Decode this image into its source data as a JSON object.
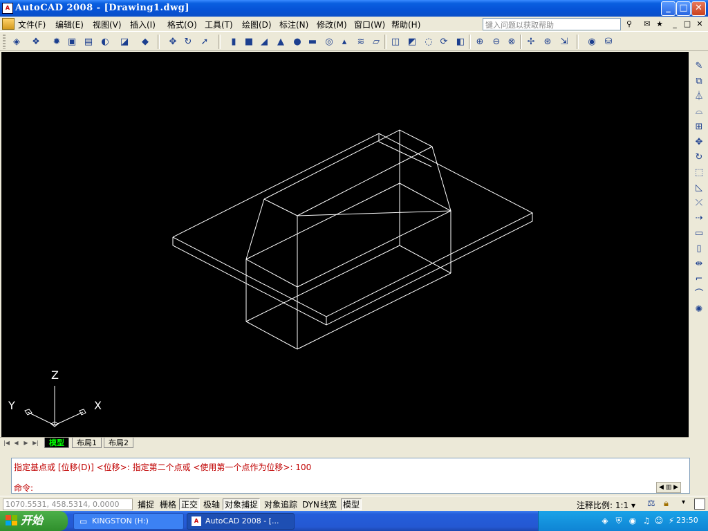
{
  "window": {
    "title": "AutoCAD 2008 - [Drawing1.dwg]",
    "app_icon_text": "A",
    "minimize": "_",
    "maximize": "□",
    "close": "✕"
  },
  "menubar": {
    "items": [
      "文件(F)",
      "编辑(E)",
      "视图(V)",
      "插入(I)",
      "格式(O)",
      "工具(T)",
      "绘图(D)",
      "标注(N)",
      "修改(M)",
      "窗口(W)",
      "帮助(H)"
    ],
    "help_search_placeholder": "键入问题以获取帮助",
    "doc_minimize": "_",
    "doc_restore": "□",
    "doc_close": "✕"
  },
  "drawing": {
    "ucs": {
      "z_label": "Z",
      "y_label": "Y",
      "x_label": "X"
    }
  },
  "layout_tabs": {
    "tabs": [
      "模型",
      "布局1",
      "布局2"
    ],
    "active": "模型"
  },
  "command": {
    "history_line": "指定基点或 [位移(D)] <位移>:  指定第二个点或 <使用第一个点作为位移>: 100",
    "prompt": "命令:"
  },
  "statusbar": {
    "coordinates": "1070.5531, 458.5314, 0.0000",
    "toggles": [
      {
        "label": "捕捉",
        "on": false
      },
      {
        "label": "栅格",
        "on": false
      },
      {
        "label": "正交",
        "on": true
      },
      {
        "label": "极轴",
        "on": false
      },
      {
        "label": "对象捕捉",
        "on": true
      },
      {
        "label": "对象追踪",
        "on": false
      },
      {
        "label": "DYN",
        "on": false
      },
      {
        "label": "线宽",
        "on": false
      },
      {
        "label": "模型",
        "on": true
      }
    ],
    "annotation_scale_label": "注释比例:",
    "annotation_scale_value": "1:1"
  },
  "taskbar": {
    "start_label": "开始",
    "tasks": [
      "KINGSTON (H:)",
      "AutoCAD 2008 - [..."
    ],
    "clock": "23:50"
  },
  "colors": {
    "canvas": "#000000",
    "wireframe": "#ffffff",
    "command_text": "#c00000",
    "model_tab_text": "#00ff00"
  }
}
